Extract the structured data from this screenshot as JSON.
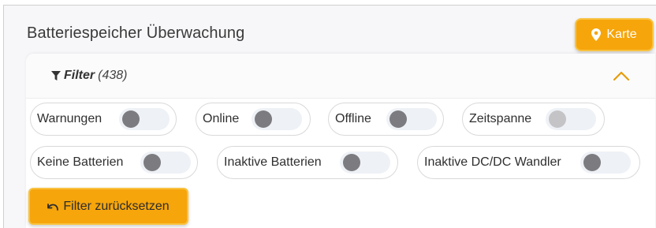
{
  "header": {
    "title": "Batteriespeicher Überwachung",
    "map_button_label": "Karte",
    "map_button_icon": "map-marker-icon",
    "accent_color": "#f6a50b"
  },
  "filter": {
    "label": "Filter",
    "count": "(438)",
    "expanded": true,
    "toggles_row1": [
      {
        "label": "Warnungen",
        "on": false,
        "enabled": true
      },
      {
        "label": "Online",
        "on": false,
        "enabled": true
      },
      {
        "label": "Offline",
        "on": false,
        "enabled": true
      },
      {
        "label": "Zeitspanne",
        "on": false,
        "enabled": false
      }
    ],
    "toggles_row2": [
      {
        "label": "Keine Batterien",
        "on": false,
        "enabled": true
      },
      {
        "label": "Inaktive Batterien",
        "on": false,
        "enabled": true
      },
      {
        "label": "Inaktive DC/DC Wandler",
        "on": false,
        "enabled": true
      }
    ],
    "reset_label": "Filter zurücksetzen"
  }
}
